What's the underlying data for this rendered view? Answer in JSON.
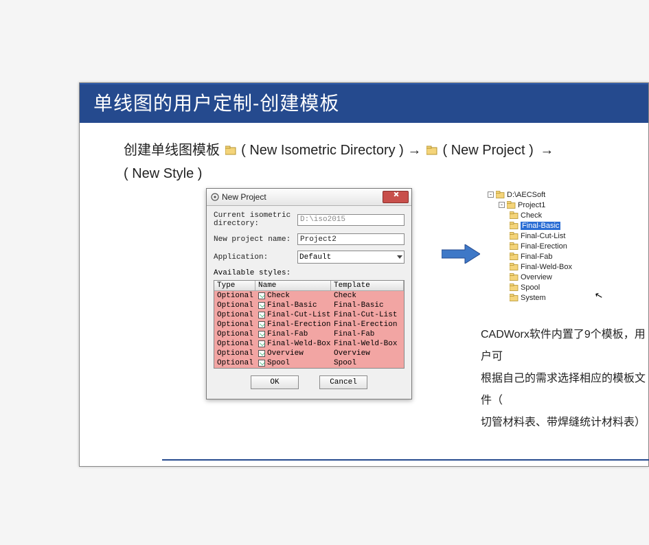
{
  "slide": {
    "title": "单线图的用户定制-创建模板",
    "flow_prefix": "创建单线图模板",
    "flow_part1": "( New Isometric Directory )",
    "flow_arrow": "→",
    "flow_part2": "( New Project )",
    "flow_line2": "( New Style )"
  },
  "dialog": {
    "title": "New Project",
    "label_dir": "Current isometric directory:",
    "value_dir": "D:\\iso2015",
    "label_name": "New project name:",
    "value_name": "Project2",
    "label_app": "Application:",
    "value_app": "Default",
    "label_avail": "Available styles:",
    "header_type": "Type",
    "header_name": "Name",
    "header_template": "Template",
    "rows": [
      {
        "type": "Optional",
        "name": "Check",
        "template": "Check"
      },
      {
        "type": "Optional",
        "name": "Final-Basic",
        "template": "Final-Basic"
      },
      {
        "type": "Optional",
        "name": "Final-Cut-List",
        "template": "Final-Cut-List"
      },
      {
        "type": "Optional",
        "name": "Final-Erection",
        "template": "Final-Erection"
      },
      {
        "type": "Optional",
        "name": "Final-Fab",
        "template": "Final-Fab"
      },
      {
        "type": "Optional",
        "name": "Final-Weld-Box",
        "template": "Final-Weld-Box"
      },
      {
        "type": "Optional",
        "name": "Overview",
        "template": "Overview"
      },
      {
        "type": "Optional",
        "name": "Spool",
        "template": "Spool"
      }
    ],
    "ok": "OK",
    "cancel": "Cancel"
  },
  "tree": {
    "root": "D:\\AECSoft",
    "project": "Project1",
    "items": [
      "Check",
      "Final-Basic",
      "Final-Cut-List",
      "Final-Erection",
      "Final-Fab",
      "Final-Weld-Box",
      "Overview",
      "Spool",
      "System"
    ],
    "selected_index": 1
  },
  "body": {
    "line1": "CADWorx软件内置了9个模板，用户可",
    "line2": "根据自己的需求选择相应的模板文件（",
    "line3": "切管材料表、带焊缝统计材料表）"
  }
}
